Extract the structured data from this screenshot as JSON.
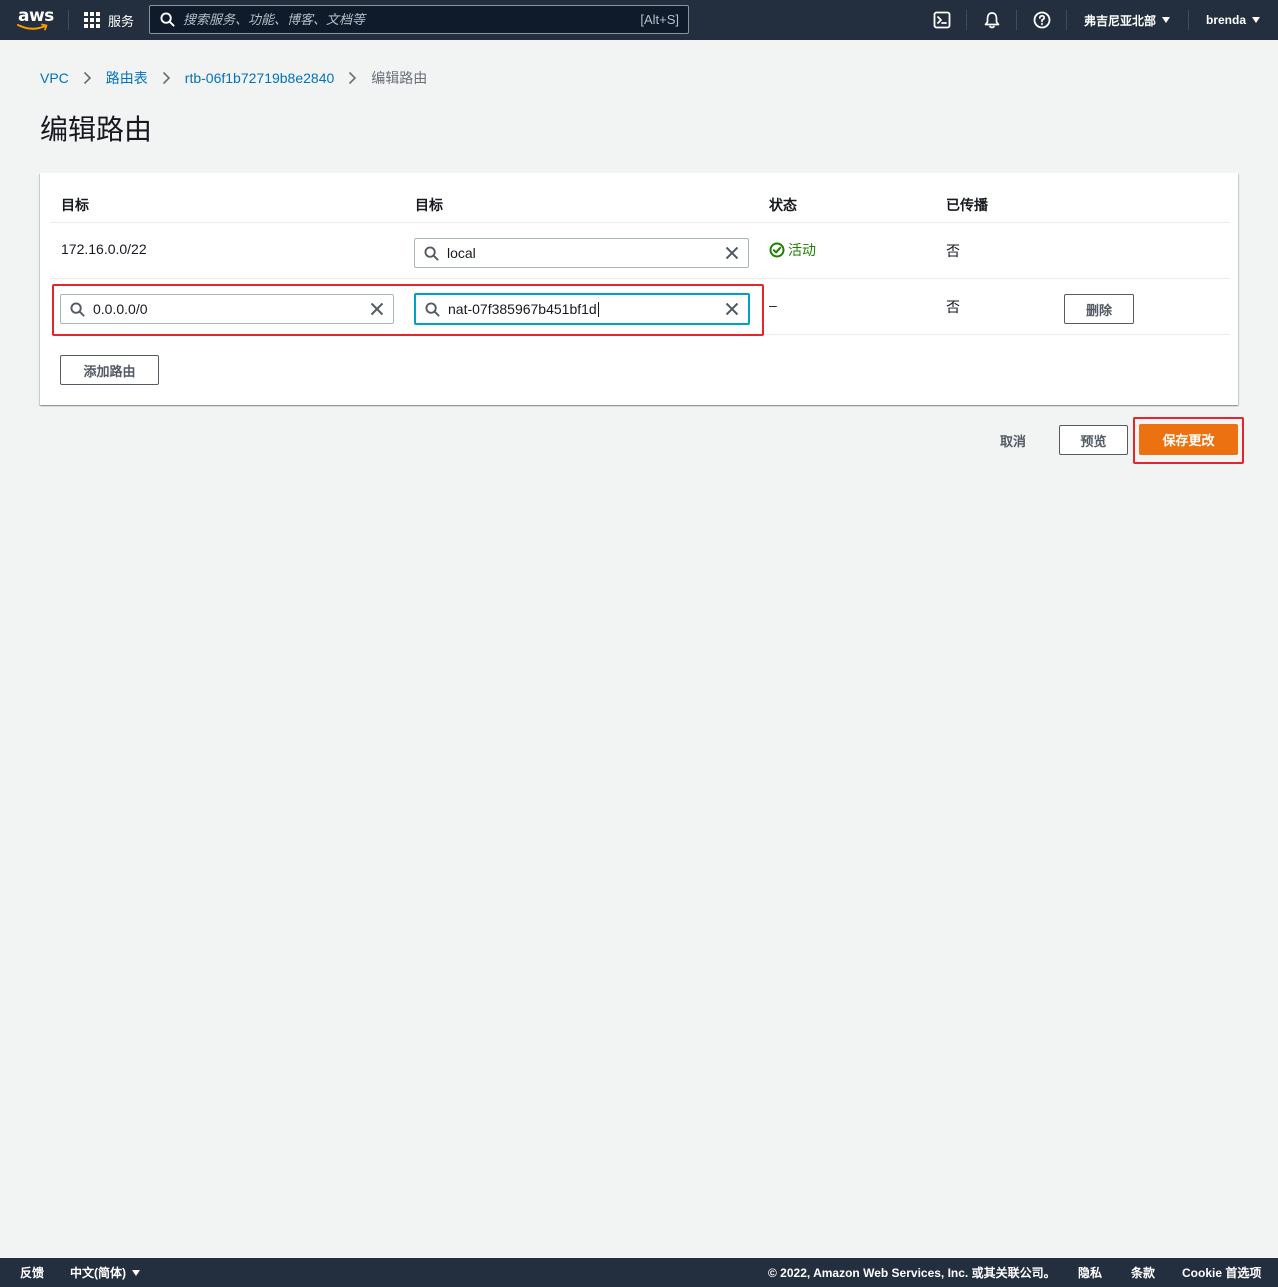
{
  "topnav": {
    "logo": "aws",
    "services_label": "服务",
    "search_placeholder": "搜索服务、功能、博客、文档等",
    "search_shortcut": "[Alt+S]",
    "region": "弗吉尼亚北部",
    "user": "brenda",
    "icons": [
      "cloudshell-icon",
      "bell-icon",
      "help-icon"
    ]
  },
  "breadcrumb": {
    "items": [
      "VPC",
      "路由表",
      "rtb-06f1b72719b8e2840"
    ],
    "current": "编辑路由"
  },
  "page_title": "编辑路由",
  "table": {
    "headers": [
      "目标",
      "目标",
      "状态",
      "已传播"
    ],
    "rows": [
      {
        "destination": "172.16.0.0/22",
        "target": "local",
        "status": "活动",
        "propagated": "否"
      },
      {
        "destination": "0.0.0.0/0",
        "target": "nat-07f385967b451bf1d",
        "status": "–",
        "propagated": "否",
        "remove_label": "删除"
      }
    ],
    "add_route_label": "添加路由"
  },
  "actions": {
    "cancel": "取消",
    "preview": "预览",
    "save": "保存更改"
  },
  "footer": {
    "feedback": "反馈",
    "language": "中文(简体)",
    "copyright": "© 2022, Amazon Web Services, Inc. 或其关联公司。",
    "privacy": "隐私",
    "terms": "条款",
    "cookies": "Cookie 首选项"
  },
  "colors": {
    "nav_bg": "#232f3e",
    "link": "#0073bb",
    "primary": "#ec7211",
    "success": "#1d8102",
    "focus": "#00a1c9",
    "highlight": "#e4252b"
  }
}
